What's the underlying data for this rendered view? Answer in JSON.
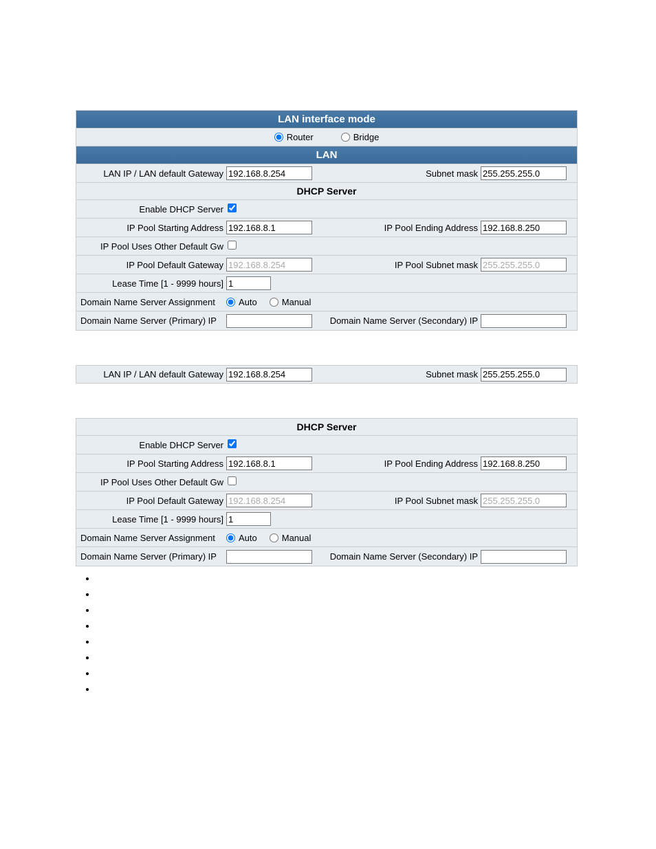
{
  "headers": {
    "lan_interface_mode": "LAN interface mode",
    "lan": "LAN",
    "dhcp_server": "DHCP Server"
  },
  "mode": {
    "router_label": "Router",
    "bridge_label": "Bridge",
    "selected": "router"
  },
  "lan": {
    "lan_ip_label": "LAN IP / LAN default Gateway",
    "lan_ip_value": "192.168.8.254",
    "subnet_label": "Subnet mask",
    "subnet_value": "255.255.255.0"
  },
  "dhcp": {
    "enable_label": "Enable DHCP Server",
    "enable_checked": true,
    "pool_start_label": "IP Pool Starting Address",
    "pool_start_value": "192.168.8.1",
    "pool_end_label": "IP Pool Ending Address",
    "pool_end_value": "192.168.8.250",
    "uses_other_gw_label": "IP Pool Uses Other Default Gw",
    "uses_other_gw_checked": false,
    "default_gw_label": "IP Pool Default Gateway",
    "default_gw_value": "192.168.8.254",
    "pool_subnet_label": "IP Pool Subnet mask",
    "pool_subnet_value": "255.255.255.0",
    "lease_label": "Lease Time [1 - 9999 hours]",
    "lease_value": "1",
    "dns_assign_label": "Domain Name Server Assignment",
    "dns_auto_label": "Auto",
    "dns_manual_label": "Manual",
    "dns_assign_selected": "auto",
    "dns_primary_label": "Domain Name Server (Primary) IP",
    "dns_primary_value": "",
    "dns_secondary_label": "Domain Name Server (Secondary) IP",
    "dns_secondary_value": ""
  },
  "bullets": [
    "",
    "",
    "",
    "",
    "",
    "",
    "",
    ""
  ]
}
